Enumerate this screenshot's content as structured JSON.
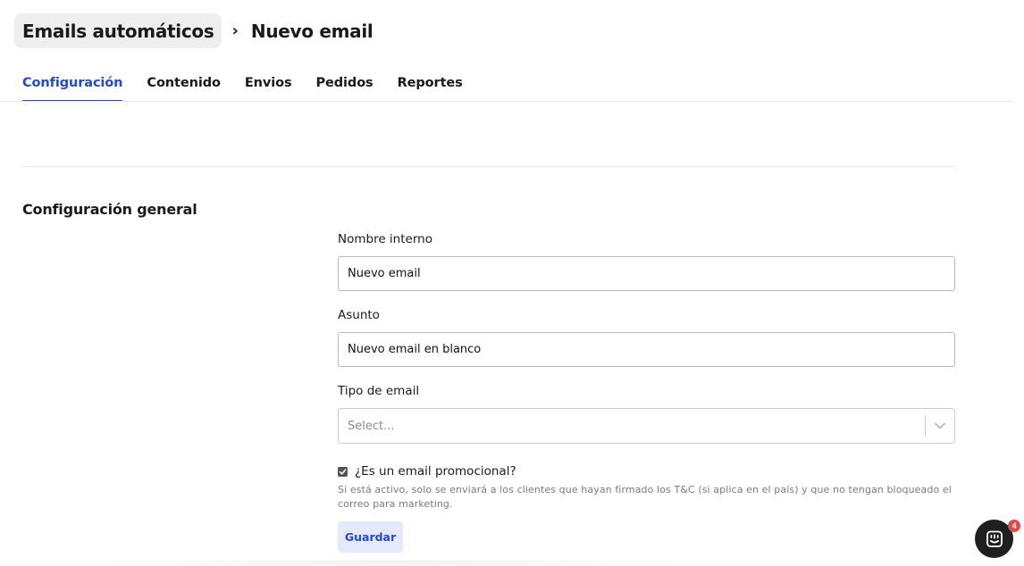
{
  "breadcrumb": {
    "parent": "Emails automáticos",
    "separator": "›",
    "current": "Nuevo email"
  },
  "tabs": [
    {
      "label": "Configuración",
      "active": true
    },
    {
      "label": "Contenido",
      "active": false
    },
    {
      "label": "Envios",
      "active": false
    },
    {
      "label": "Pedidos",
      "active": false
    },
    {
      "label": "Reportes",
      "active": false
    }
  ],
  "section": {
    "title": "Configuración general"
  },
  "form": {
    "internal_name": {
      "label": "Nombre interno",
      "value": "Nuevo email"
    },
    "subject": {
      "label": "Asunto",
      "value": "Nuevo email en blanco"
    },
    "email_type": {
      "label": "Tipo de email",
      "placeholder": "Select..."
    },
    "promotional": {
      "label": "¿Es un email promocional?",
      "checked": true,
      "helper": "Si está activo, solo se enviará a los clientes que hayan firmado los T&C (si aplica en el país) y que no tengan bloqueado el correo para marketing."
    },
    "save_label": "Guardar"
  },
  "chat": {
    "icon": "chat-icon",
    "badge_count": "4"
  },
  "colors": {
    "accent": "#2449d8",
    "accent_bg": "#e6e9fb",
    "badge": "#e5484d"
  }
}
